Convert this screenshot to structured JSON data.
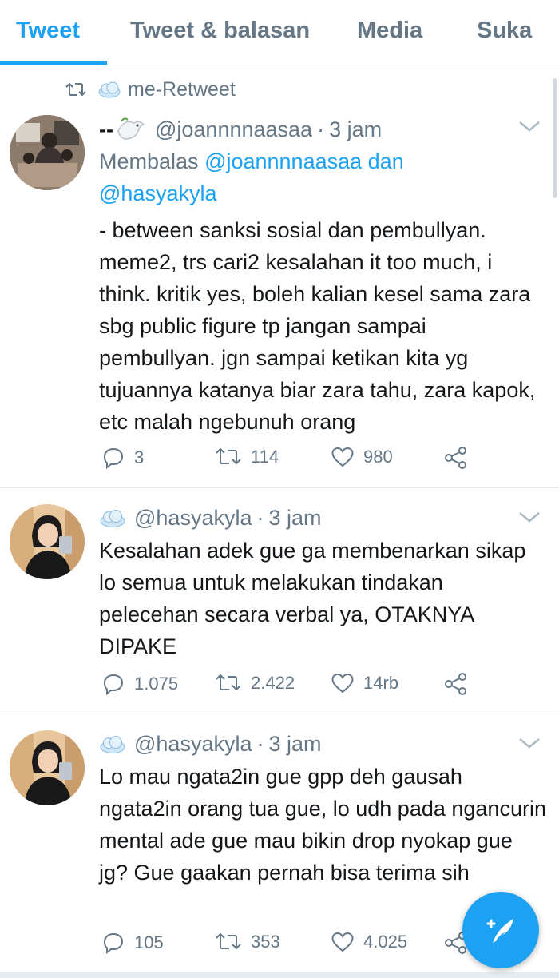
{
  "tabs": [
    {
      "label": "Tweet",
      "active": true
    },
    {
      "label": "Tweet & balasan",
      "active": false
    },
    {
      "label": "Media",
      "active": false
    },
    {
      "label": "Suka",
      "active": false
    }
  ],
  "retweet_row": {
    "icon": "retweet-icon",
    "emoji": "cloud-emoji",
    "label": "me-Retweet"
  },
  "tweets": [
    {
      "display_name": "--",
      "name_emoji": "dove-emoji",
      "handle": "@joannnnaasaa",
      "time": "3 jam",
      "reply_prefix": "Membalas",
      "reply_mention_1": "@joannnnaasaa",
      "reply_conj": "dan",
      "reply_mention_2": "@hasyakyla",
      "text": "- between sanksi sosial dan pembullyan. meme2, trs cari2 kesalahan it too much, i think. kritik yes, boleh kalian kesel sama zara sbg public figure tp jangan sampai pembullyan. jgn sampai ketikan kita yg tujuannya katanya biar zara tahu, zara kapok, etc malah ngebunuh orang",
      "replies": "3",
      "retweets": "114",
      "likes": "980"
    },
    {
      "name_emoji": "cloud-emoji",
      "handle": "@hasyakyla",
      "time": "3 jam",
      "text": "Kesalahan adek gue ga membenarkan sikap lo semua untuk melakukan tindakan pelecehan secara verbal ya, OTAKNYA DIPAKE",
      "replies": "1.075",
      "retweets": "2.422",
      "likes": "14rb"
    },
    {
      "name_emoji": "cloud-emoji",
      "handle": "@hasyakyla",
      "time": "3 jam",
      "text": "Lo mau ngata2in gue gpp deh gausah ngata2in orang tua gue, lo udh pada ngancurin mental ade gue mau bikin drop nyokap gue jg? Gue gaakan pernah bisa terima sih",
      "replies": "105",
      "retweets": "353",
      "likes": "4.025"
    }
  ],
  "colors": {
    "accent": "#1da1f2",
    "muted": "#657786",
    "text": "#14171a",
    "divider": "#e1e8ed"
  },
  "fab": {
    "icon": "compose-tweet-icon"
  }
}
